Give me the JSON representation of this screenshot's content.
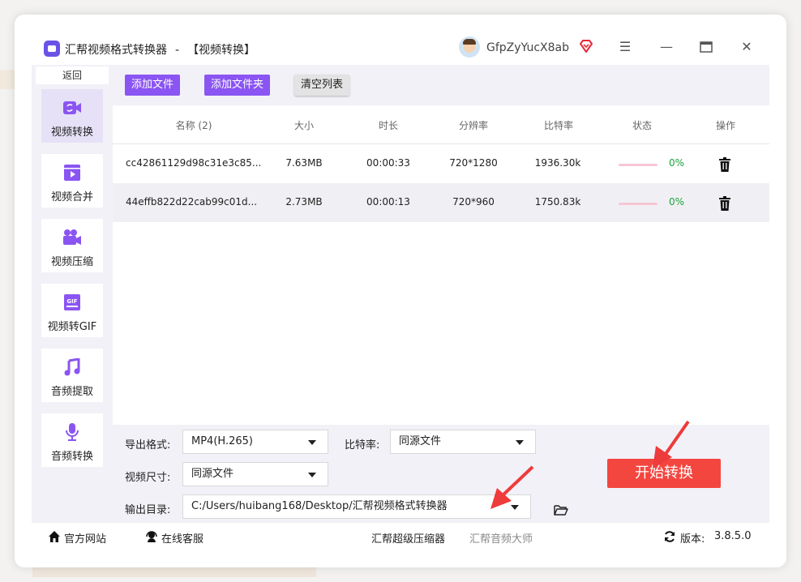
{
  "window": {
    "app_name": "汇帮视频格式转换器",
    "separator": "-",
    "page_name": "【视频转换】",
    "username": "GfpZyYucX8ab"
  },
  "sidebar": {
    "back_label": "返回",
    "items": [
      {
        "label": "视频转换",
        "icon": "video-convert-icon",
        "active": true
      },
      {
        "label": "视频合并",
        "icon": "video-merge-icon",
        "active": false
      },
      {
        "label": "视频压缩",
        "icon": "video-compress-icon",
        "active": false
      },
      {
        "label": "视频转GIF",
        "icon": "gif-icon",
        "active": false
      },
      {
        "label": "音频提取",
        "icon": "music-note-icon",
        "active": false
      },
      {
        "label": "音频转换",
        "icon": "microphone-icon",
        "active": false
      }
    ]
  },
  "toolbar": {
    "add_file": "添加文件",
    "add_folder": "添加文件夹",
    "clear_list": "清空列表"
  },
  "table": {
    "headers": [
      "名称 (2)",
      "大小",
      "时长",
      "分辨率",
      "比特率",
      "状态",
      "操作"
    ],
    "rows": [
      {
        "name": "cc42861129d98c31e3c85...",
        "size": "7.63MB",
        "duration": "00:00:33",
        "resolution": "720*1280",
        "bitrate": "1936.30k",
        "progress": 0,
        "progress_label": "0%"
      },
      {
        "name": "44effb822d22cab99c01d...",
        "size": "2.73MB",
        "duration": "00:00:13",
        "resolution": "720*960",
        "bitrate": "1750.83k",
        "progress": 0,
        "progress_label": "0%"
      }
    ]
  },
  "settings": {
    "format_label": "导出格式:",
    "format_value": "MP4(H.265)",
    "bitrate_label": "比特率:",
    "bitrate_value": "同源文件",
    "size_label": "视频尺寸:",
    "size_value": "同源文件",
    "output_label": "输出目录:",
    "output_value": "C:/Users/huibang168/Desktop/汇帮视频格式转换器",
    "start_label": "开始转换"
  },
  "footer": {
    "website": "官方网站",
    "support": "在线客服",
    "link1": "汇帮超级压缩器",
    "link2": "汇帮音频大师",
    "version_label": "版本:",
    "version": "3.8.5.0"
  },
  "colors": {
    "accent": "#8a55f2",
    "start": "#f3463f",
    "progress_ok": "#1aa33b"
  }
}
